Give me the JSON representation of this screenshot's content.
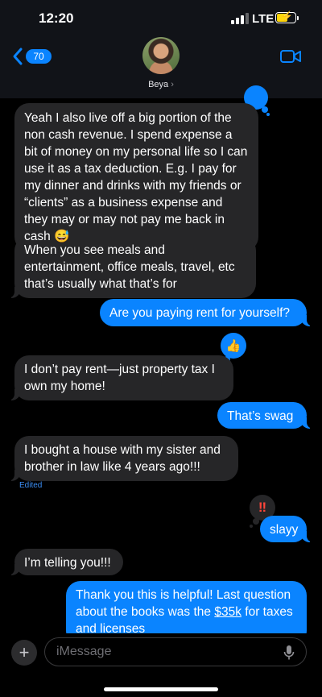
{
  "status_bar": {
    "time": "12:20",
    "carrier": "LTE"
  },
  "header": {
    "back_count": "70",
    "contact_name": "Beya",
    "name_chevron": "›"
  },
  "messages": [
    {
      "id": "m1",
      "side": "in",
      "text": "Yeah I also live off a big portion of the non cash revenue. I spend expense a bit of money on my personal life so I can use it as a tax deduction. E.g. I pay for my dinner and drinks with my friends or “clients” as a business expense and they may or may not pay me back in cash 😅",
      "tapback": "blue"
    },
    {
      "id": "m2",
      "side": "in",
      "text": "When you see meals and entertainment, office meals, travel, etc that’s usually what that’s for"
    },
    {
      "id": "m3",
      "side": "out",
      "text": "Are you paying rent for yourself?"
    },
    {
      "id": "m4",
      "side": "in",
      "text": "I don’t pay rent—just property tax I own my home!",
      "tapback": "thumbs-up"
    },
    {
      "id": "m5",
      "side": "out",
      "text": "That’s swag"
    },
    {
      "id": "m6",
      "side": "in",
      "text": "I bought a house with my sister and brother in law like 4 years ago!!!",
      "edited": "Edited"
    },
    {
      "id": "m7",
      "side": "out",
      "text": "slayy",
      "tapback": "double-exclamation"
    },
    {
      "id": "m8",
      "side": "in",
      "text": "I’m telling you!!!"
    },
    {
      "id": "m9",
      "side": "out",
      "text_before": "Thank you this is helpful! Last question about the books was the ",
      "link": "$35k",
      "text_after": " for taxes and licenses"
    }
  ],
  "tapbacks": {
    "thumbs_up": "👍",
    "exclaim": "‼"
  },
  "input": {
    "placeholder": "iMessage",
    "plus": "+"
  },
  "colors": {
    "sent_bubble": "#0a84ff",
    "received_bubble": "#262628",
    "edited_label": "#3b8ef5"
  }
}
